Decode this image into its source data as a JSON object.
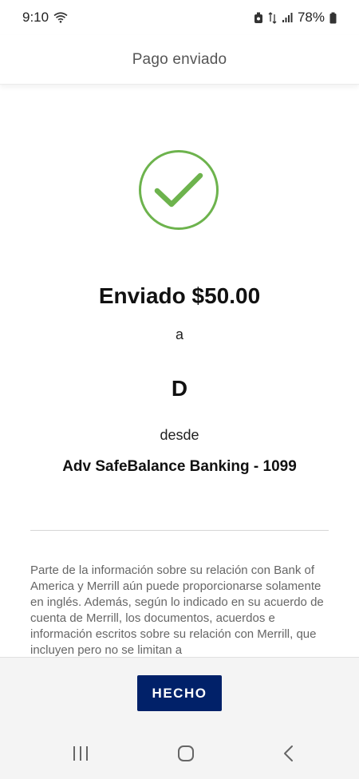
{
  "status_bar": {
    "time": "9:10",
    "battery": "78%",
    "icons": [
      "wifi-icon",
      "screen-record-icon",
      "data-transfer-icon",
      "signal-icon",
      "battery-icon"
    ]
  },
  "header": {
    "title": "Pago enviado"
  },
  "confirmation": {
    "icon": "checkmark-circle-icon",
    "icon_color": "#6db34d",
    "amount_text": "Enviado $50.00",
    "to_text": "a",
    "payee": "D",
    "from_text": "desde",
    "account": "Adv SafeBalance Banking - 1099"
  },
  "disclaimer": {
    "text": "Parte de la información sobre su relación con Bank of America y Merrill aún puede proporcionarse solamente en inglés. Además, según lo indicado en su acuerdo de cuenta de Merrill, los documentos, acuerdos e información escritos sobre su relación con Merrill, que incluyen pero no se limitan a"
  },
  "footer": {
    "done_label": "HECHO",
    "button_color": "#012169"
  },
  "nav_bar": {
    "icons": [
      "recent-apps-icon",
      "home-icon",
      "back-icon"
    ]
  }
}
